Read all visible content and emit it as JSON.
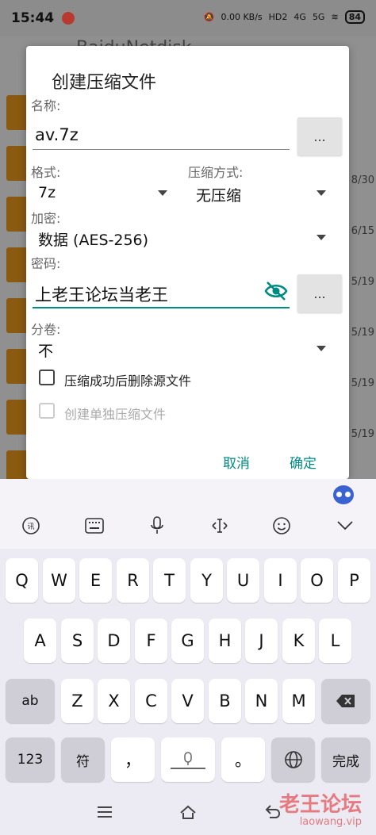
{
  "status_bar": {
    "time": "15:44",
    "net_speed": "0.00 KB/s",
    "hd": "HD2",
    "signal1": "4G",
    "signal2": "5G",
    "battery": "84"
  },
  "background_app": {
    "title": "BaiduNetdisk",
    "dates": [
      "8/30",
      "6/15",
      "5/19",
      "5/19",
      "5/19",
      "5/19"
    ]
  },
  "dialog": {
    "title": "创建压缩文件",
    "name_label": "名称:",
    "name_value": "av.7z",
    "browse_label": "...",
    "format_label": "格式:",
    "format_value": "7z",
    "compression_label": "压缩方式:",
    "compression_value": "无压缩",
    "encryption_label": "加密:",
    "encryption_value": "数据 (AES-256)",
    "password_label": "密码:",
    "password_value": "上老王论坛当老王",
    "volume_label": "分卷:",
    "volume_value": "不",
    "delete_source_label": "压缩成功后删除源文件",
    "separate_archive_label": "创建单独压缩文件",
    "cancel_label": "取消",
    "ok_label": "确定",
    "accent_color": "#008a84"
  },
  "keyboard": {
    "row1": [
      "Q",
      "W",
      "E",
      "R",
      "T",
      "Y",
      "U",
      "I",
      "O",
      "P"
    ],
    "row2": [
      "A",
      "S",
      "D",
      "F",
      "G",
      "H",
      "J",
      "K",
      "L"
    ],
    "row3": [
      "Z",
      "X",
      "C",
      "V",
      "B",
      "N",
      "M"
    ],
    "shift_label": "ab",
    "num_label": "123",
    "symbol_label": "符",
    "comma_label": "，",
    "period_label": "。",
    "enter_label": "完成"
  },
  "watermark": {
    "text": "老王论坛",
    "url": "laowang.vip"
  }
}
